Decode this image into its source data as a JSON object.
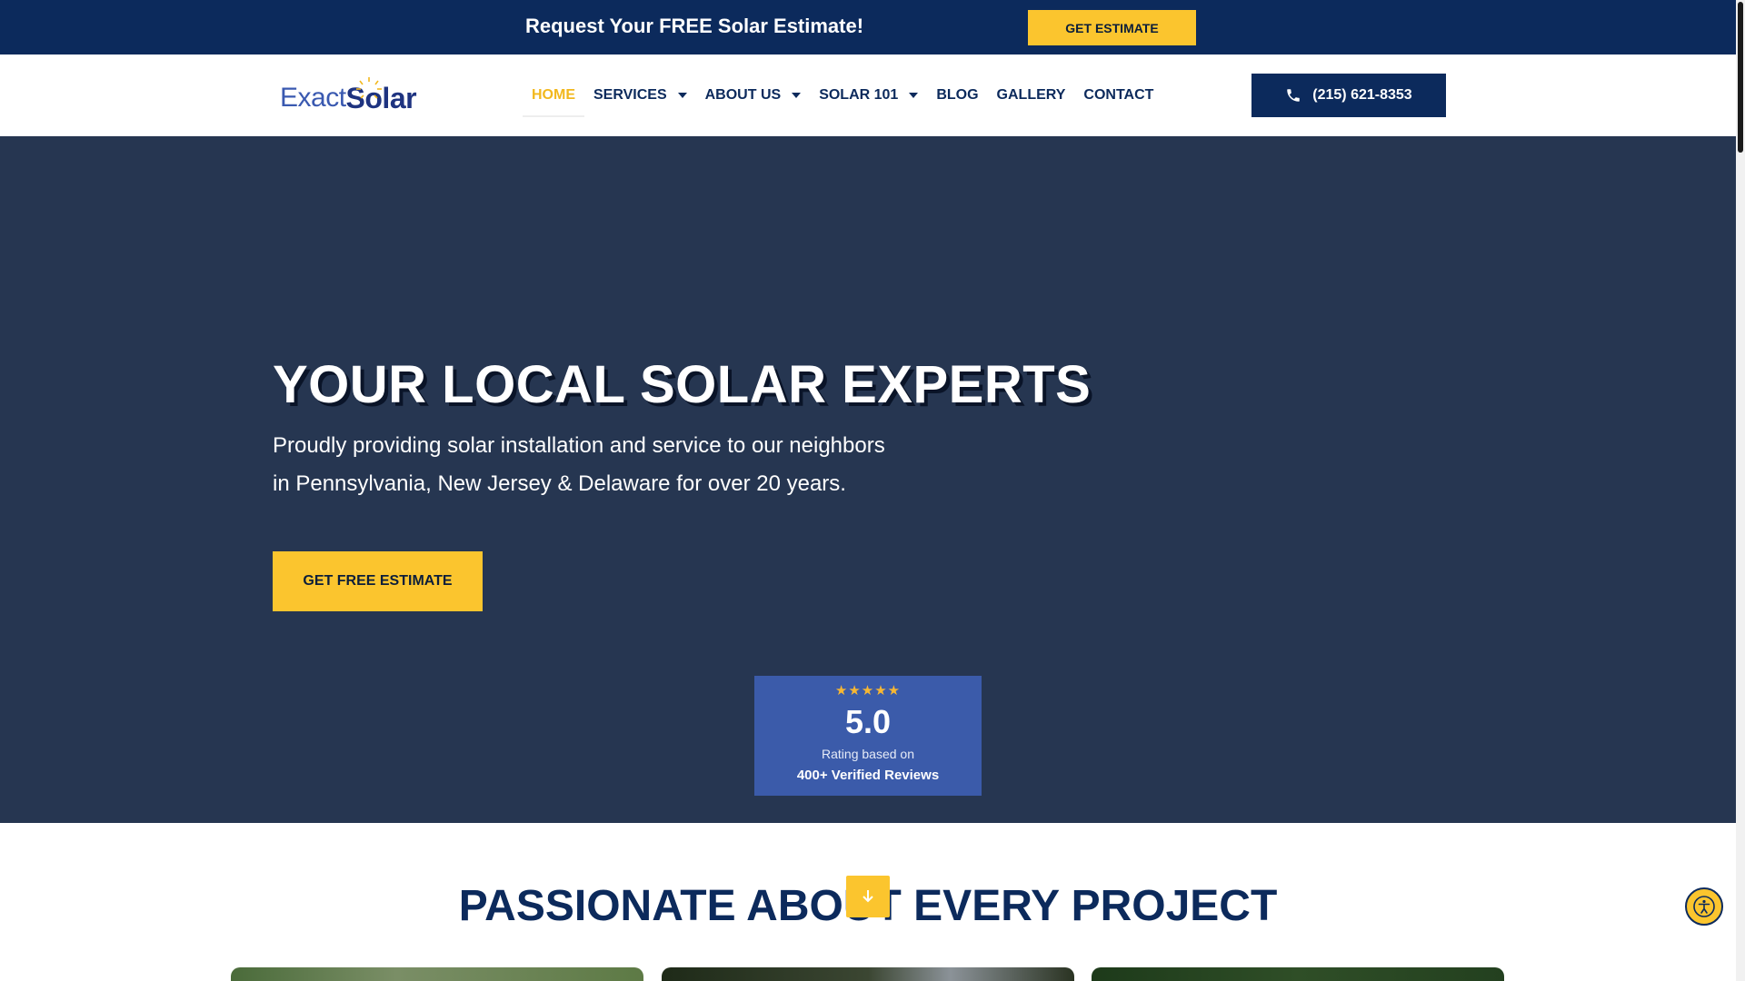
{
  "topbar": {
    "promo_text": "Request Your FREE Solar Estimate!",
    "cta_label": "GET ESTIMATE"
  },
  "header": {
    "logo": {
      "part1": "Exact",
      "part2": "Solar"
    },
    "nav": [
      {
        "label": "HOME",
        "active": true,
        "dropdown": false
      },
      {
        "label": "SERVICES",
        "active": false,
        "dropdown": true
      },
      {
        "label": "ABOUT US",
        "active": false,
        "dropdown": true
      },
      {
        "label": "SOLAR 101",
        "active": false,
        "dropdown": true
      },
      {
        "label": "BLOG",
        "active": false,
        "dropdown": false
      },
      {
        "label": "GALLERY",
        "active": false,
        "dropdown": false
      },
      {
        "label": "CONTACT",
        "active": false,
        "dropdown": false
      }
    ],
    "phone": "(215) 621-8353"
  },
  "hero": {
    "title": "YOUR LOCAL SOLAR EXPERTS",
    "subtitle_line1": "Proudly providing solar installation and service to our neighbors",
    "subtitle_line2": "in Pennsylvania, New Jersey & Delaware for over 20 years.",
    "cta_label": "GET FREE ESTIMATE",
    "rating": {
      "stars": "★★★★★",
      "score": "5.0",
      "based_on": "Rating based on",
      "count": "400+ Verified Reviews"
    }
  },
  "section": {
    "title": "PASSIONATE ABOUT EVERY PROJECT"
  },
  "colors": {
    "navy": "#0c2a5c",
    "hero_bg": "#263651",
    "accent_yellow": "#fbc52e",
    "rating_blue": "#3b5baa"
  },
  "icons": {
    "phone": "phone-icon",
    "scroll": "arrow-down-icon",
    "accessibility": "accessibility-icon"
  }
}
